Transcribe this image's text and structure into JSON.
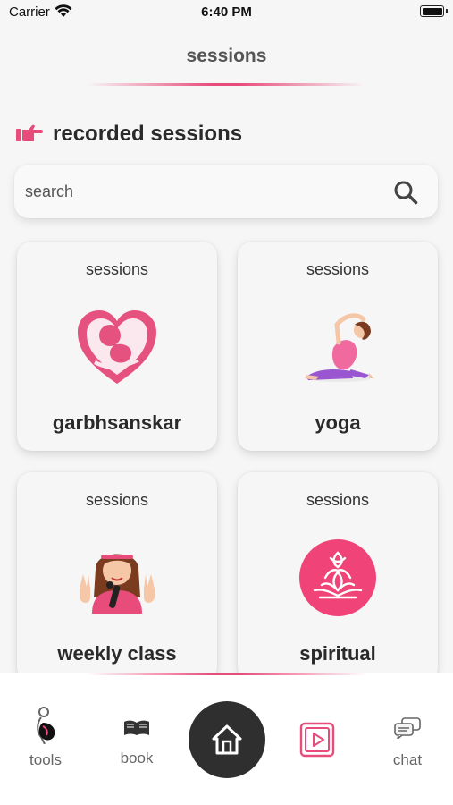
{
  "status": {
    "carrier": "Carrier",
    "time": "6:40 PM"
  },
  "header": {
    "title": "sessions"
  },
  "section": {
    "heading": "recorded sessions",
    "icon": "pointing-hand-icon"
  },
  "search": {
    "placeholder": "search",
    "value": ""
  },
  "cards": [
    {
      "subtitle": "sessions",
      "title": "garbhsanskar",
      "icon": "baby-in-heart-icon"
    },
    {
      "subtitle": "sessions",
      "title": "yoga",
      "icon": "yoga-pose-icon"
    },
    {
      "subtitle": "sessions",
      "title": "weekly class",
      "icon": "teacher-microphone-icon"
    },
    {
      "subtitle": "sessions",
      "title": "spiritual",
      "icon": "lotus-meditation-icon"
    }
  ],
  "nav": {
    "tools": "tools",
    "book": "book",
    "chat": "chat"
  },
  "colors": {
    "accent": "#e84c7b",
    "nav_dark": "#2f2f2f"
  }
}
